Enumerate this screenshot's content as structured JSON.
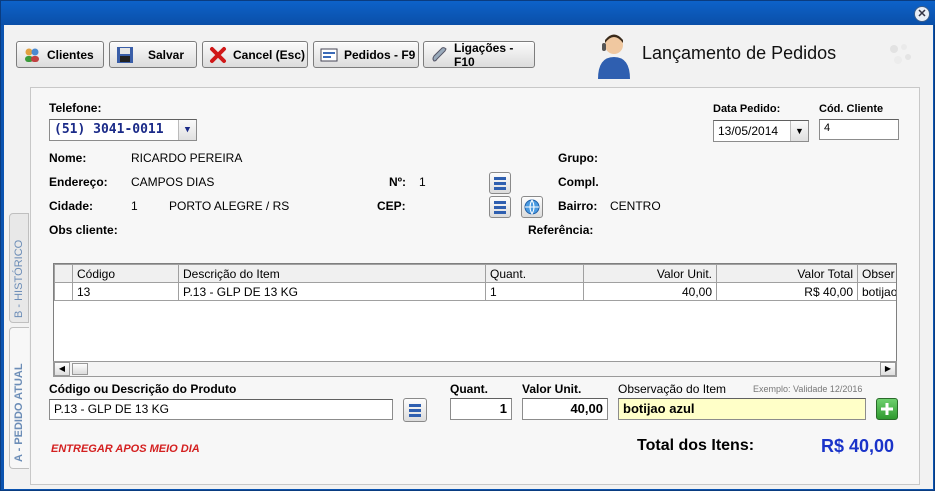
{
  "window": {
    "close_glyph": "✕"
  },
  "toolbar": {
    "clientes": "Clientes",
    "salvar": "Salvar",
    "cancel": "Cancel (Esc)",
    "pedidos": "Pedidos - F9",
    "ligacoes": "Ligações - F10"
  },
  "brand": {
    "title": "Lançamento de Pedidos"
  },
  "tabs": {
    "historico": "B - HISTÓRICO",
    "atual": "A - PEDIDO ATUAL"
  },
  "form": {
    "telefone_label": "Telefone:",
    "telefone_value": "(51) 3041-0011",
    "data_label": "Data Pedido:",
    "data_value": "13/05/2014",
    "cod_cliente_label": "Cód. Cliente",
    "cod_cliente_value": "4",
    "nome_label": "Nome:",
    "nome_value": "RICARDO PEREIRA",
    "grupo_label": "Grupo:",
    "endereco_label": "Endereço:",
    "endereco_value": "CAMPOS DIAS",
    "numero_label": "Nº:",
    "numero_value": "1",
    "compl_label": "Compl.",
    "cidade_label": "Cidade:",
    "cidade_code": "1",
    "cidade_value": "PORTO ALEGRE / RS",
    "cep_label": "CEP:",
    "bairro_label": "Bairro:",
    "bairro_value": "CENTRO",
    "obs_label": "Obs cliente:",
    "referencia_label": "Referência:"
  },
  "grid": {
    "headers": [
      "Código",
      "Descrição do Item",
      "Quant.",
      "Valor Unit.",
      "Valor Total",
      "Obser"
    ],
    "rows": [
      [
        "13",
        "P.13 - GLP DE 13 KG",
        "1",
        "40,00",
        "R$ 40,00",
        "botijao"
      ]
    ]
  },
  "entry": {
    "produto_label": "Código ou Descrição do Produto",
    "produto_value": "P.13 - GLP DE 13 KG",
    "quant_label": "Quant.",
    "quant_value": "1",
    "valor_label": "Valor Unit.",
    "valor_value": "40,00",
    "obs_label": "Observação do Item",
    "obs_hint": "Exemplo: Validade 12/2016",
    "obs_value": "botijao azul"
  },
  "footer": {
    "note": "ENTREGAR APOS MEIO DIA",
    "total_label": "Total dos Itens:",
    "total_value": "R$ 40,00"
  },
  "colors": {
    "accent_total": "#1a33c9",
    "note_red": "#d42020",
    "obs_bg": "#ffffc8"
  }
}
